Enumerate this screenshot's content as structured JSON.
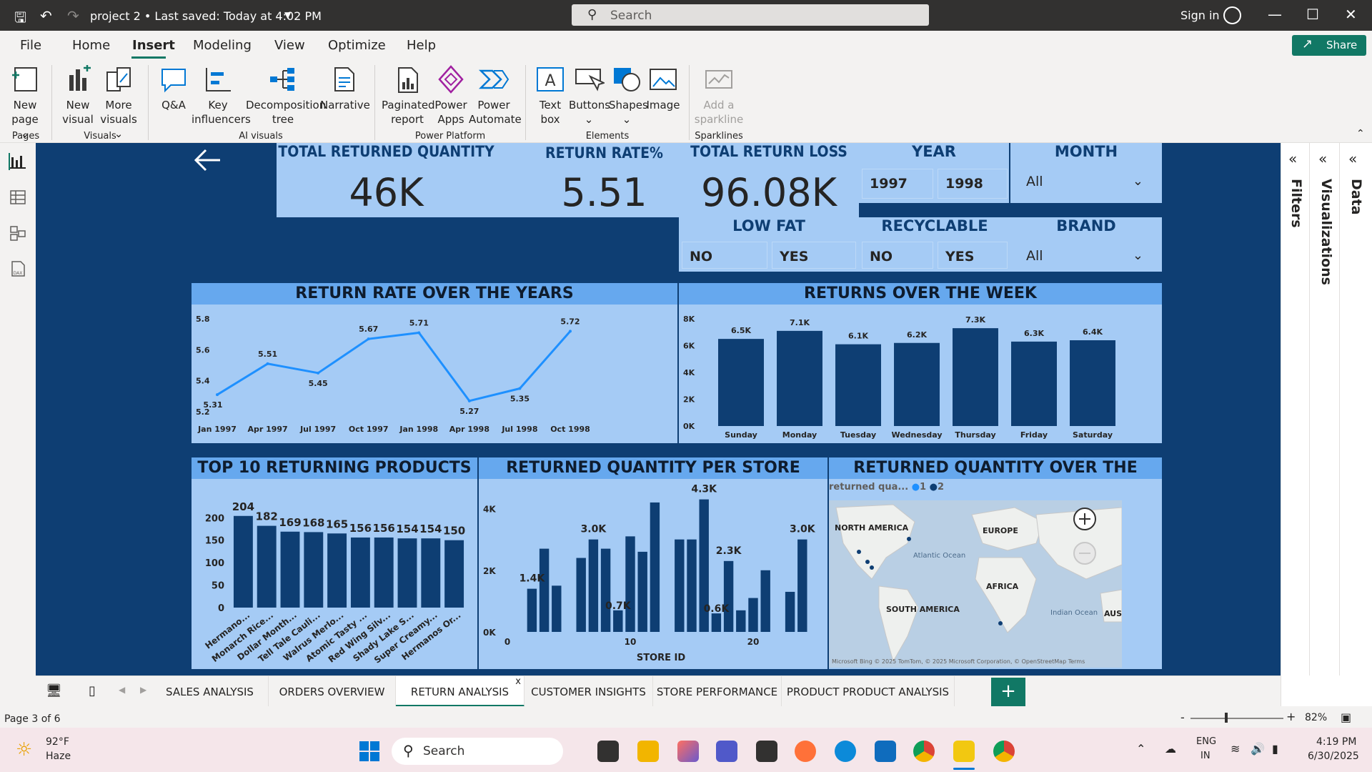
{
  "window": {
    "doc_title": "project 2 • Last saved: Today at 4:02 PM",
    "search_placeholder": "Search",
    "sign_in": "Sign in"
  },
  "menu": {
    "items": [
      "File",
      "Home",
      "Insert",
      "Modeling",
      "View",
      "Optimize",
      "Help"
    ],
    "active": "Insert",
    "share": "Share"
  },
  "ribbon": {
    "buttons": {
      "new_page": "New page ⌄",
      "new_visual": "New visual",
      "more_visuals": "More visuals ⌄",
      "qna": "Q&A",
      "key_influencers": "Key influencers",
      "decomposition_tree": "Decomposition tree",
      "narrative": "Narrative",
      "paginated_report": "Paginated report",
      "power_apps": "Power Apps",
      "power_automate": "Power Automate",
      "text_box": "Text box",
      "buttons": "Buttons ⌄",
      "shapes": "Shapes ⌄",
      "image": "Image",
      "add_sparkline": "Add a sparkline"
    },
    "groups": {
      "pages": "Pages",
      "visuals": "Visuals",
      "ai_visuals": "AI visuals",
      "power_platform": "Power Platform",
      "elements": "Elements",
      "sparklines": "Sparklines"
    }
  },
  "panes": {
    "filters": "Filters",
    "visualizations": "Visualizations",
    "data": "Data"
  },
  "tabs": [
    "SALES ANALYSIS",
    "ORDERS OVERVIEW",
    "RETURN ANALYSIS",
    "CUSTOMER INSIGHTS",
    "STORE PERFORMANCE",
    "PRODUCT PRODUCT ANALYSIS"
  ],
  "active_tab": "RETURN ANALYSIS",
  "tab_close": "x",
  "status": {
    "page": "Page 3 of 6",
    "zoom": "82%"
  },
  "taskbar": {
    "weather_temp": "92°F",
    "weather_desc": "Haze",
    "search": "Search",
    "lang1": "ENG",
    "lang2": "IN",
    "time": "4:19 PM",
    "date": "6/30/2025"
  },
  "kpis": {
    "total_returned_quantity": {
      "title": "TOTAL RETURNED QUANTITY",
      "value": "46K"
    },
    "return_rate": {
      "title": "RETURN RATE%",
      "value": "5.51"
    },
    "total_return_loss": {
      "title": "TOTAL RETURN LOSS",
      "value": "96.08K"
    }
  },
  "slicers": {
    "year": {
      "title": "YEAR",
      "options": [
        "1997",
        "1998"
      ]
    },
    "month": {
      "title": "MONTH",
      "value": "All"
    },
    "low_fat": {
      "title": "LOW FAT",
      "options": [
        "NO",
        "YES"
      ]
    },
    "recyclable": {
      "title": "RECYCLABLE",
      "options": [
        "NO",
        "YES"
      ]
    },
    "brand": {
      "title": "BRAND",
      "value": "All"
    }
  },
  "chart_data": [
    {
      "type": "line",
      "title": "RETURN RATE OVER THE YEARS",
      "categories": [
        "Jan 1997",
        "Apr 1997",
        "Jul 1997",
        "Oct 1997",
        "Jan 1998",
        "Apr 1998",
        "Jul 1998",
        "Oct 1998"
      ],
      "values": [
        5.31,
        5.51,
        5.45,
        5.67,
        5.71,
        5.27,
        5.35,
        5.72
      ],
      "yticks": [
        "5.8",
        "5.6",
        "5.4",
        "5.2"
      ],
      "ylim": [
        5.2,
        5.8
      ],
      "color": "#1e90ff"
    },
    {
      "type": "bar",
      "title": "RETURNS OVER THE WEEK",
      "categories": [
        "Sunday",
        "Monday",
        "Tuesday",
        "Wednesday",
        "Thursday",
        "Friday",
        "Saturday"
      ],
      "values": [
        6500,
        7100,
        6100,
        6200,
        7300,
        6300,
        6400
      ],
      "labels": [
        "6.5K",
        "7.1K",
        "6.1K",
        "6.2K",
        "7.3K",
        "6.3K",
        "6.4K"
      ],
      "yticks": [
        "8K",
        "6K",
        "4K",
        "2K",
        "0K"
      ],
      "ylim": [
        0,
        8000
      ],
      "color": "#0e3e73"
    },
    {
      "type": "bar",
      "title": "TOP 10 RETURNING PRODUCTS",
      "categories": [
        "Hermano...",
        "Monarch Rice...",
        "Dollar Month...",
        "Tell Tale Cauli...",
        "Walrus Merlo...",
        "Atomic Tasty ...",
        "Red Wing Silv...",
        "Shady Lake S...",
        "Super Creamy...",
        "Hermanos Or..."
      ],
      "values": [
        204,
        182,
        169,
        168,
        165,
        156,
        156,
        154,
        154,
        150
      ],
      "yticks": [
        "200",
        "150",
        "100",
        "50",
        "0"
      ],
      "ylim": [
        0,
        210
      ],
      "color": "#0e3e73"
    },
    {
      "type": "bar",
      "title": "RETURNED QUANTITY PER STORE",
      "x": [
        2,
        3,
        4,
        5,
        6,
        7,
        8,
        9,
        10,
        11,
        12,
        13,
        14,
        15,
        16,
        17,
        18,
        19,
        20,
        21,
        22,
        23,
        24
      ],
      "values": [
        1400,
        2700,
        1500,
        null,
        2400,
        3000,
        2700,
        700,
        3100,
        2600,
        4200,
        null,
        3000,
        3000,
        4300,
        600,
        2300,
        700,
        1100,
        2000,
        null,
        1300,
        3000
      ],
      "labels": [
        {
          "x": 2,
          "text": "1.4K"
        },
        {
          "x": 7,
          "text": "3.0K"
        },
        {
          "x": 9,
          "text": "0.7K"
        },
        {
          "x": 16,
          "text": "4.3K"
        },
        {
          "x": 17,
          "text": "0.6K"
        },
        {
          "x": 18,
          "text": "2.3K"
        },
        {
          "x": 24,
          "text": "3.0K"
        }
      ],
      "xticks": [
        "0",
        "10",
        "20"
      ],
      "yticks": [
        "4K",
        "2K",
        "0K"
      ],
      "xlabel": "STORE ID",
      "ylim": [
        0,
        4500
      ],
      "color": "#0e3e73"
    },
    {
      "type": "map",
      "title": "RETURNED QUANTITY OVER THE REGION",
      "legend_title": "returned qua...",
      "legend": [
        "1",
        "2"
      ],
      "labels": [
        "NORTH AMERICA",
        "EUROPE",
        "Atlantic Ocean",
        "AFRICA",
        "SOUTH AMERICA",
        "Indian Ocean",
        "AUSTI"
      ],
      "attribution": "Microsoft Bing   © 2025 TomTom, © 2025 Microsoft Corporation, © OpenStreetMap  Terms"
    }
  ]
}
